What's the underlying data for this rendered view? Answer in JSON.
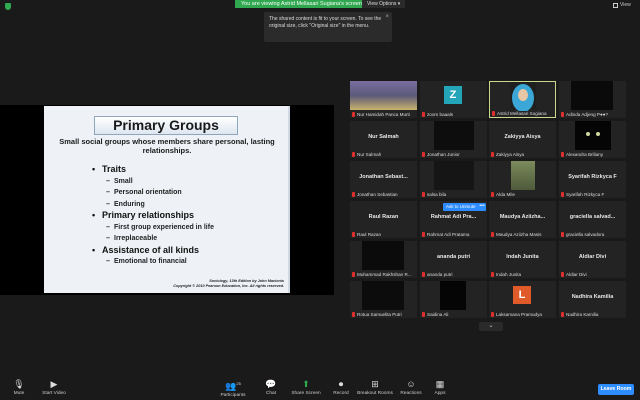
{
  "topbar": {
    "share_banner": "You are viewing Astrid Mellasari Sugiana's screen",
    "view_options": "View Options ▾",
    "view_label": "View"
  },
  "tooltip": {
    "text": "The shared content is fit to your screen. To see the original size, click \"Original size\" in the menu."
  },
  "slide": {
    "title": "Primary Groups",
    "subtitle": "Small social groups whose members share personal, lasting relationships.",
    "bullets": [
      {
        "label": "Traits",
        "subs": [
          "Small",
          "Personal orientation",
          "Enduring"
        ]
      },
      {
        "label": "Primary relationships",
        "subs": [
          "First group experienced in life",
          "Irreplaceable"
        ]
      },
      {
        "label": "Assistance of all kinds",
        "subs": [
          "Emotional to financial"
        ]
      }
    ],
    "credit_line1": "Sociology, 13th Edition by John Macionis",
    "credit_line2": "Copyright © 2010 Pearson Education, Inc.  All rights reserved."
  },
  "gallery": [
    {
      "label": "Nur Hamidah Panca Murti",
      "name": ""
    },
    {
      "label": "zoom baaals",
      "name": "",
      "letter": "Z"
    },
    {
      "label": "Astrid Mellasari Sugiana",
      "name": ""
    },
    {
      "label": "Adinda Adjeng P●●?",
      "name": ""
    },
    {
      "label": "Nur Salmah",
      "name": "Nur Salmah"
    },
    {
      "label": "Jonathan Junior",
      "name": ""
    },
    {
      "label": "Zakiyya Aisya",
      "name": "Zakiyya Aisya"
    },
    {
      "label": "Alexandra Briliany",
      "name": ""
    },
    {
      "label": "Jonathan Sebastian",
      "name": "Jonathan  Sebast..."
    },
    {
      "label": "salsa bila",
      "name": ""
    },
    {
      "label": "Alda Mile",
      "name": ""
    },
    {
      "label": "Syarifah Rizkyca F",
      "name": "Syarifah Rizkyca F"
    },
    {
      "label": "Raul Razan",
      "name": "Raul Razan"
    },
    {
      "label": "Rahmat Adi Pratama",
      "name": "Rahmat  Adi  Pra..."
    },
    {
      "label": "Maudya Aziizha Masis",
      "name": "Maudya  Aziizha..."
    },
    {
      "label": "graciella salvadora",
      "name": "graciella  salvad..."
    },
    {
      "label": "Muhammad Rakhshan R...",
      "name": ""
    },
    {
      "label": "ananda putri",
      "name": "ananda putri"
    },
    {
      "label": "Indah Junita",
      "name": "Indah Junita"
    },
    {
      "label": "Aldiar Divi",
      "name": "Aldiar Divi"
    },
    {
      "label": "Rotua Samuelita Putri",
      "name": ""
    },
    {
      "label": "Saidina Ali",
      "name": ""
    },
    {
      "label": "Laksamana Pramudya",
      "name": "",
      "letter": "L"
    },
    {
      "label": "Nadhira Kamilia",
      "name": "Nadhira Kamilia"
    }
  ],
  "ask_to_unmute": "Ask to Unmute",
  "more_dots": "•••",
  "toolbar": {
    "mute": "Mute",
    "start_video": "Start Video",
    "participants": "Participants",
    "participants_count": "25",
    "chat": "Chat",
    "share_screen": "Share Screen",
    "record": "Record",
    "breakout": "Breakout Rooms",
    "reactions": "Reactions",
    "apps": "Apps",
    "leave": "Leave Room"
  },
  "colors": {
    "accent": "#2d8cff",
    "green": "#2fa84f",
    "muted_red": "#e0302e"
  }
}
